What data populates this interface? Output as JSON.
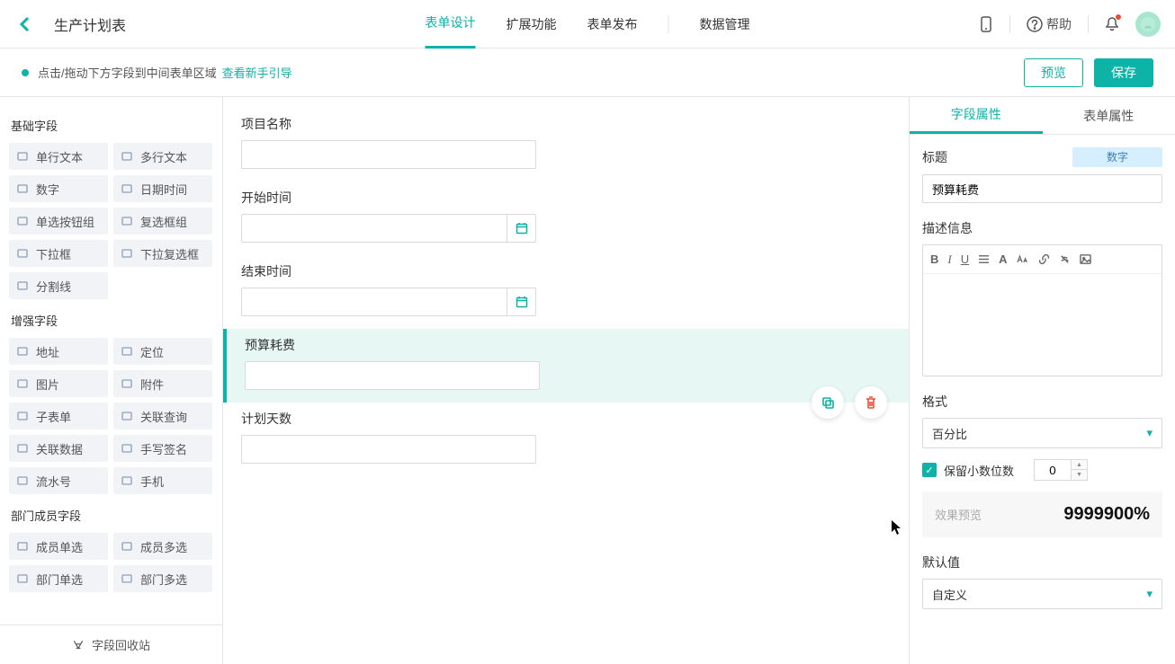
{
  "header": {
    "title": "生产计划表",
    "tabs": [
      "表单设计",
      "扩展功能",
      "表单发布",
      "数据管理"
    ],
    "help": "帮助"
  },
  "subheader": {
    "hint": "点击/拖动下方字段到中间表单区域",
    "link": "查看新手引导",
    "preview_btn": "预览",
    "save_btn": "保存"
  },
  "left": {
    "group1_title": "基础字段",
    "group1_items": [
      "单行文本",
      "多行文本",
      "数字",
      "日期时间",
      "单选按钮组",
      "复选框组",
      "下拉框",
      "下拉复选框",
      "分割线"
    ],
    "group2_title": "增强字段",
    "group2_items": [
      "地址",
      "定位",
      "图片",
      "附件",
      "子表单",
      "关联查询",
      "关联数据",
      "手写签名",
      "流水号",
      "手机"
    ],
    "group3_title": "部门成员字段",
    "group3_items": [
      "成员单选",
      "成员多选",
      "部门单选",
      "部门多选"
    ],
    "recycle": "字段回收站"
  },
  "center": {
    "fields": [
      {
        "label": "项目名称",
        "type": "text"
      },
      {
        "label": "开始时间",
        "type": "date"
      },
      {
        "label": "结束时间",
        "type": "date"
      },
      {
        "label": "预算耗费",
        "type": "number",
        "selected": true
      },
      {
        "label": "计划天数",
        "type": "number"
      }
    ]
  },
  "right": {
    "tabs": [
      "字段属性",
      "表单属性"
    ],
    "title_label": "标题",
    "type_badge": "数字",
    "title_value": "预算耗费",
    "desc_label": "描述信息",
    "format_label": "格式",
    "format_value": "百分比",
    "decimal_label": "保留小数位数",
    "decimal_value": "0",
    "preview_label": "效果预览",
    "preview_value": "9999900%",
    "default_label": "默认值",
    "default_value": "自定义"
  }
}
